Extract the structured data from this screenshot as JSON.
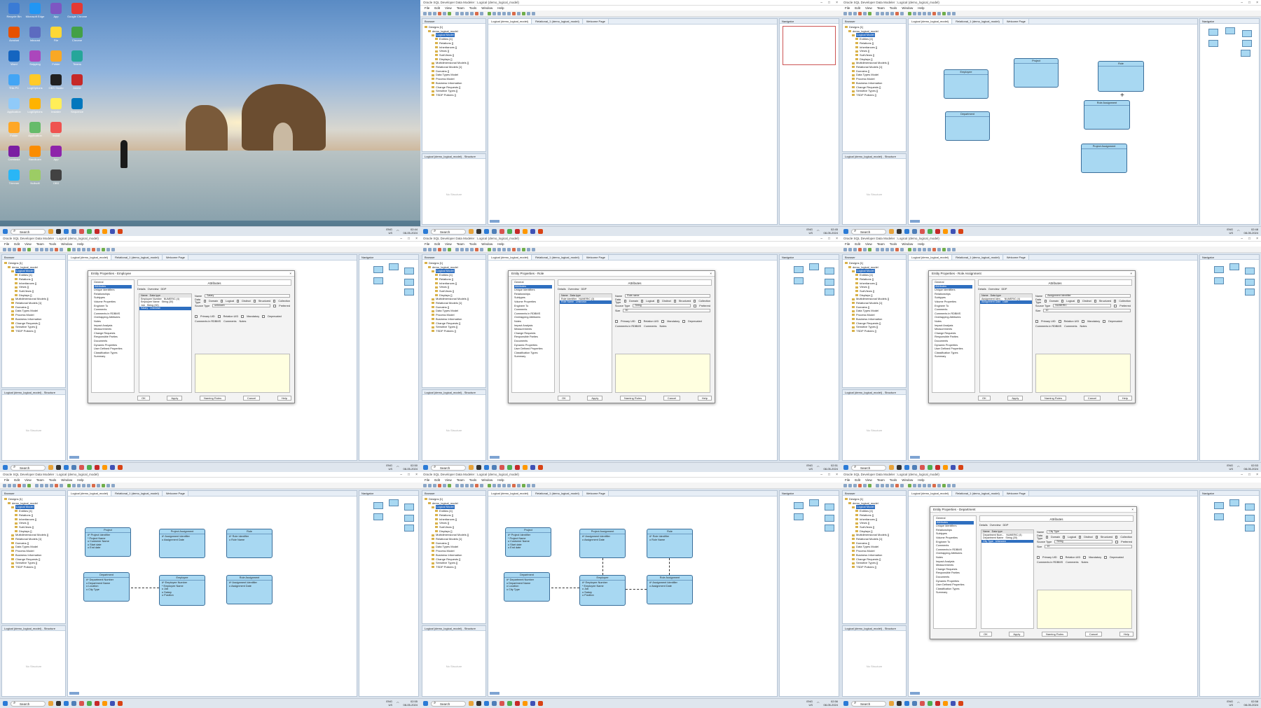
{
  "app": {
    "window_title": "Oracle SQL Developer Data Modeler : Logical (demo_logical_model)",
    "menu": [
      "File",
      "Edit",
      "View",
      "Team",
      "Tools",
      "Window",
      "Help"
    ],
    "browser_title": "Browser",
    "navigator_title": "Navigator",
    "structure_title": "Logical (demo_logical_model) - Structure",
    "no_structure": "No Structure",
    "tabs": [
      "Logical (demo_logical_model)",
      "Relational_1 (demo_logical_model)",
      "Welcome Page"
    ],
    "tree": [
      "Designs [1]",
      "demo_logical_model",
      "Logical Model",
      "Entities [4]",
      "Relations []",
      "Inheritances []",
      "Views []",
      "SubViews []",
      "Displays []",
      "Multidimensional Models []",
      "Relational Models [1]",
      "Domains []",
      "Data Types Model",
      "Process Model",
      "Business Information",
      "Change Requests []",
      "Sensitive Types []",
      "TSDP Policies []"
    ]
  },
  "taskbar": {
    "search": "Search",
    "lang": "ENG",
    "region": "US",
    "clocks": [
      "02:44",
      "02:45",
      "02:48",
      "02:50",
      "02:51",
      "02:53",
      "02:55",
      "02:56",
      "02:58"
    ],
    "date": "08-05-2024"
  },
  "desktop_icons": [
    "Recycle Bin",
    "Microsoft Edge",
    "App",
    "Google Chrome",
    "Acrobat",
    "Inbound",
    "File",
    "Chrome",
    "Word",
    "Snipping",
    "Folder",
    "Teams",
    "This PC",
    "LogiOptions",
    "OBS Studio",
    "Adobe",
    "Application",
    "LogiOptions",
    "Installer",
    "Sequence",
    "Folder",
    "Application",
    "Install",
    "",
    "Camtasia",
    "Bandicam",
    "App",
    "",
    "Trimmer",
    "Nullsoft",
    "OBS"
  ],
  "entities": {
    "employee": {
      "name": "Employee",
      "attrs": [
        "#* Employee Number",
        "* Employee Name",
        "o Job",
        "o Salary",
        "o Position"
      ]
    },
    "project": {
      "name": "Project",
      "attrs": [
        "#* Project Identifier",
        "* Project Name",
        "o Customer Name",
        "o Start date",
        "o End date"
      ]
    },
    "role": {
      "name": "Role",
      "attrs": [
        "#* Role Identifier",
        "o Role Name"
      ]
    },
    "department": {
      "name": "Department",
      "attrs": [
        "#* Department Number",
        "o Department Name",
        "o Location",
        "o City Type"
      ]
    },
    "project_assignment": {
      "name": "Project Assignment",
      "attrs": [
        "#* Assignment Identifier",
        "o Assignment Date"
      ]
    },
    "role_assignment": {
      "name": "Role Assignment",
      "attrs": [
        "#* Assignment Identifier",
        "o Assignment Date"
      ]
    }
  },
  "dialogs": {
    "sections": [
      "General",
      "Attributes",
      "Unique Identifiers",
      "Relationships",
      "Subtypes",
      "Volume Properties",
      "Engineer To",
      "Comments",
      "Comments in RDBMS",
      "Overlapping Attributes",
      "Notes",
      "Impact Analysis",
      "Measurements",
      "Change Requests",
      "Responsible Parties",
      "Documents",
      "Dynamic Properties",
      "User Defined Properties",
      "Classification Types",
      "Summary"
    ],
    "section_title": "Attributes",
    "subtabs": [
      "Details",
      "Overview",
      "DDP"
    ],
    "list_header": [
      "Name",
      "Data type"
    ],
    "labels": {
      "name": "Name",
      "data_type": "Data Type",
      "domain": "Domain",
      "logical": "Logical",
      "distinct": "Distinct",
      "structured": "Structured",
      "collection": "Collection",
      "source_type": "Source Type",
      "preferred": "Preferred",
      "size": "Size",
      "units": "Units",
      "precision": "Precision",
      "scale": "Scale",
      "primary_uid": "Primary UID",
      "relation_uid": "Relation UID",
      "mandatory": "Mandatory",
      "deprecated": "Deprecated",
      "comments_rdbms": "Comments in RDBMS",
      "comments": "Comments",
      "notes": "Notes"
    },
    "buttons": [
      "OK",
      "Apply",
      "Naming Rules",
      "Cancel",
      "Help"
    ],
    "employee": {
      "title": "Entity Properties - Employee",
      "rows": [
        [
          "Employee Number",
          "NUMERIC (4)"
        ],
        [
          "Employee Name",
          "String (30)"
        ],
        [
          "Job",
          "String (30)"
        ],
        [
          "Salary",
          "Unknown"
        ]
      ],
      "name_value": "Salary",
      "source_value": "unknown"
    },
    "role": {
      "title": "Entity Properties - Role",
      "rows": [
        [
          "Role Identifier",
          "NUMERIC (3)"
        ],
        [
          "Role Name",
          "Unknown"
        ]
      ],
      "name_value": "Role name",
      "source_value": "String",
      "size_value": "30"
    },
    "role_assignment": {
      "title": "Entity Properties - Role Assignment",
      "rows": [
        [
          "Assignment Iden...",
          "NUMERIC (4)"
        ],
        [
          "Assignment Date",
          "Date"
        ]
      ],
      "name_value": "Assignment Identifier",
      "source_value": "NUMERIC",
      "size_value": "10"
    },
    "department": {
      "title": "Entity Properties - Department",
      "rows": [
        [
          "Department Num...",
          "NUMERIC (4)"
        ],
        [
          "Department Name",
          "String (30)"
        ],
        [
          "City Type",
          "Unknown"
        ]
      ],
      "name_value": "City Type",
      "source_value": "String",
      "size_value": "10"
    }
  }
}
